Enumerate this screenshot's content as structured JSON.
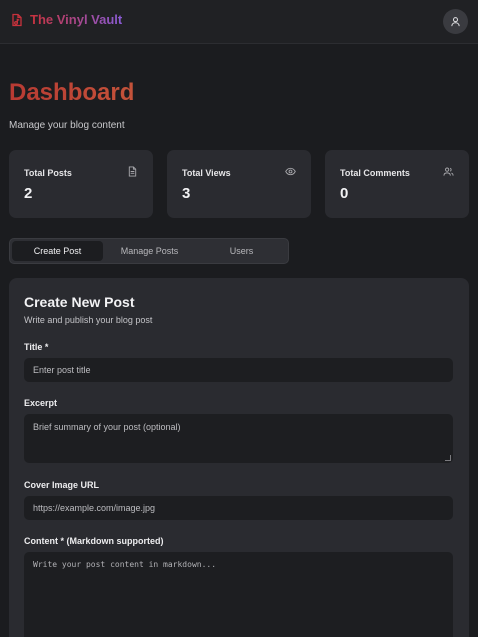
{
  "header": {
    "brand": "The Vinyl Vault",
    "brand_icon": "music-file-icon",
    "user_icon": "user-icon"
  },
  "page": {
    "title": "Dashboard",
    "subtitle": "Manage your blog content"
  },
  "stats": [
    {
      "label": "Total Posts",
      "value": "2",
      "icon": "document-icon"
    },
    {
      "label": "Total Views",
      "value": "3",
      "icon": "eye-icon"
    },
    {
      "label": "Total Comments",
      "value": "0",
      "icon": "users-icon"
    }
  ],
  "tabs": [
    {
      "label": "Create Post",
      "active": true
    },
    {
      "label": "Manage Posts",
      "active": false
    },
    {
      "label": "Users",
      "active": false
    }
  ],
  "form": {
    "title": "Create New Post",
    "subtitle": "Write and publish your blog post",
    "fields": [
      {
        "label": "Title *",
        "placeholder": "Enter post title",
        "value": ""
      },
      {
        "label": "Excerpt",
        "placeholder": "Brief summary of your post (optional)",
        "value": ""
      },
      {
        "label": "Cover Image URL",
        "placeholder": "https://example.com/image.jpg",
        "value": ""
      },
      {
        "label": "Content * (Markdown supported)",
        "placeholder": "Write your post content in markdown...",
        "value": ""
      }
    ]
  },
  "colors": {
    "background": "#1b1c1f",
    "card": "#2a2b30",
    "input": "#1d1e21",
    "brand_gradient_start": "#c8323c",
    "brand_gradient_end": "#8a5bd6",
    "title_accent": "#b83a33"
  }
}
